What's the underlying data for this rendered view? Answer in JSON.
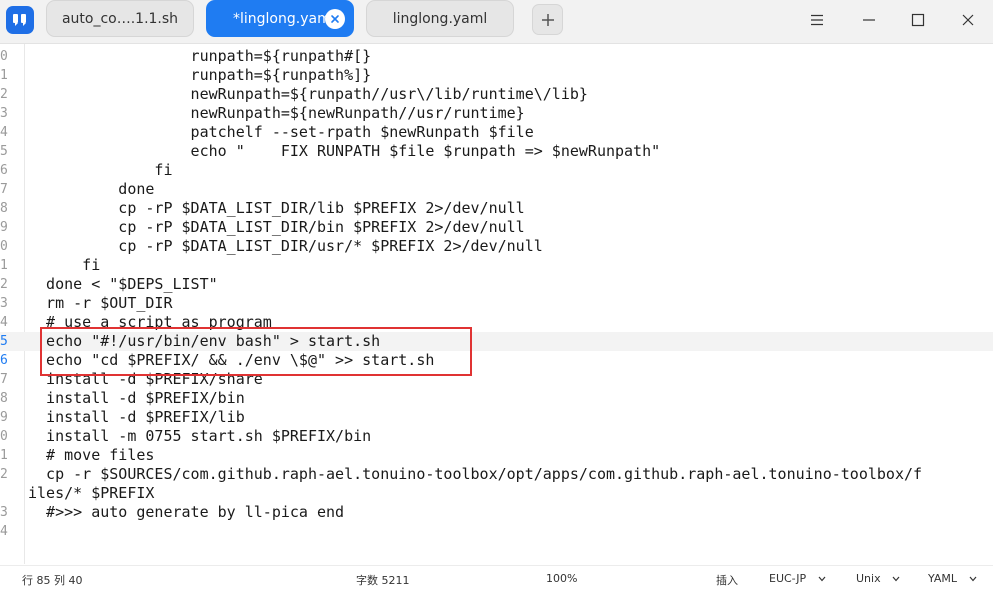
{
  "tabs": [
    {
      "label": "auto_co….1.1.sh",
      "active": false
    },
    {
      "label": "*linglong.yaml",
      "active": true
    },
    {
      "label": "linglong.yaml",
      "active": false
    }
  ],
  "editor": {
    "lines": [
      {
        "num": "0",
        "code": "                  runpath=${runpath#[}"
      },
      {
        "num": "1",
        "code": "                  runpath=${runpath%]}"
      },
      {
        "num": "2",
        "code": "                  newRunpath=${runpath//usr\\/lib/runtime\\/lib}"
      },
      {
        "num": "3",
        "code": "                  newRunpath=${newRunpath//usr/runtime}"
      },
      {
        "num": "4",
        "code": "                  patchelf --set-rpath $newRunpath $file"
      },
      {
        "num": "5",
        "code": "                  echo \"    FIX RUNPATH $file $runpath => $newRunpath\""
      },
      {
        "num": "6",
        "code": "              fi"
      },
      {
        "num": "7",
        "code": "          done"
      },
      {
        "num": "8",
        "code": "          cp -rP $DATA_LIST_DIR/lib $PREFIX 2>/dev/null"
      },
      {
        "num": "9",
        "code": "          cp -rP $DATA_LIST_DIR/bin $PREFIX 2>/dev/null"
      },
      {
        "num": "0",
        "code": "          cp -rP $DATA_LIST_DIR/usr/* $PREFIX 2>/dev/null"
      },
      {
        "num": "1",
        "code": "      fi"
      },
      {
        "num": "2",
        "code": "  done < \"$DEPS_LIST\""
      },
      {
        "num": "3",
        "code": "  rm -r $OUT_DIR"
      },
      {
        "num": "4",
        "code": "  # use a script as program"
      },
      {
        "num": "5",
        "code": "  echo \"#!/usr/bin/env bash\" > start.sh"
      },
      {
        "num": "6",
        "code": "  echo \"cd $PREFIX/ && ./env \\$@\" >> start.sh"
      },
      {
        "num": "7",
        "code": "  install -d $PREFIX/share"
      },
      {
        "num": "8",
        "code": "  install -d $PREFIX/bin"
      },
      {
        "num": "9",
        "code": "  install -d $PREFIX/lib"
      },
      {
        "num": "0",
        "code": "  install -m 0755 start.sh $PREFIX/bin"
      },
      {
        "num": "1",
        "code": "  # move files"
      },
      {
        "num": "2",
        "code": "  cp -r $SOURCES/com.github.raph-ael.tonuino-toolbox/opt/apps/com.github.raph-ael.tonuino-toolbox/f"
      },
      {
        "num": "",
        "code": "iles/* $PREFIX"
      },
      {
        "num": "3",
        "code": "  #>>> auto generate by ll-pica end"
      },
      {
        "num": "4",
        "code": ""
      }
    ]
  },
  "statusbar": {
    "position": "行 85  列 40",
    "char_count": "字数 5211",
    "zoom": "100%",
    "insert_mode": "插入",
    "encoding": "EUC-JP",
    "line_ending": "Unix",
    "language": "YAML"
  },
  "colors": {
    "accent": "#1f7cf2",
    "highlight_box": "#e03333"
  }
}
